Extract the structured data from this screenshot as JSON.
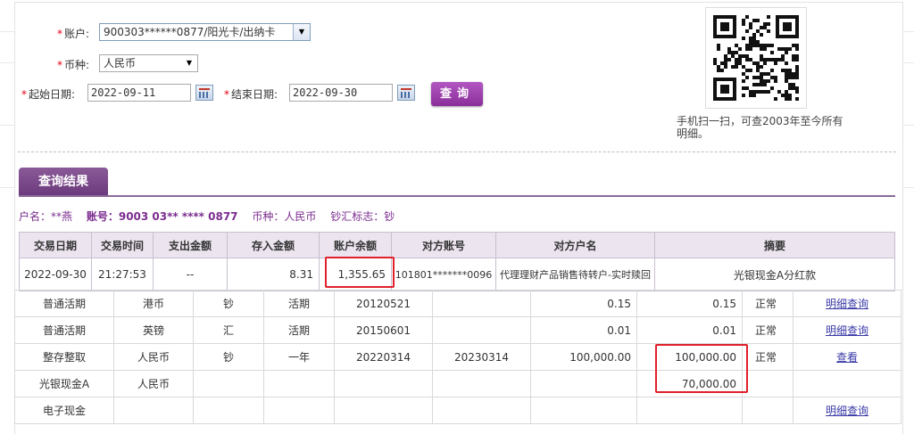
{
  "form": {
    "account_label": "账户:",
    "account_value": "900303******0877/阳光卡/出纳卡",
    "currency_label": "币种:",
    "currency_value": "人民币",
    "start_label": "起始日期:",
    "start_value": "2022-09-11",
    "end_label": "结束日期:",
    "end_value": "2022-09-30",
    "query_button": "查询"
  },
  "qr": {
    "caption": "手机扫一扫，可查2003年至今所有明细。"
  },
  "results": {
    "tab": "查询结果",
    "name": "户名：**燕",
    "account": "账号：9003 03** **** 0877",
    "currency": "币种：人民币",
    "cash_flag": "钞汇标志：钞"
  },
  "transactions": {
    "headers": [
      "交易日期",
      "交易时间",
      "支出金额",
      "存入金额",
      "账户余额",
      "对方账号",
      "对方户名",
      "摘要"
    ],
    "rows": [
      [
        "2022-09-30",
        "21:27:53",
        "--",
        "8.31",
        "1,355.65",
        "101801*******0096",
        "代理理财产品销售待转户-实时赎回",
        "光银现金A分红款"
      ]
    ]
  },
  "deposits": {
    "rows": [
      [
        "普通活期",
        "港币",
        "钞",
        "活期",
        "20120521",
        "",
        "0.15",
        "0.15",
        "正常",
        "明细查询"
      ],
      [
        "普通活期",
        "英镑",
        "汇",
        "活期",
        "20150601",
        "",
        "0.01",
        "0.01",
        "正常",
        "明细查询"
      ],
      [
        "整存整取",
        "人民币",
        "钞",
        "一年",
        "20220314",
        "20230314",
        "100,000.00",
        "100,000.00",
        "正常",
        "查看"
      ],
      [
        "光银现金A",
        "人民币",
        "",
        "",
        "",
        "",
        "",
        "70,000.00",
        "",
        ""
      ],
      [
        "电子现金",
        "",
        "",
        "",
        "",
        "",
        "",
        "",
        "",
        "明细查询"
      ]
    ]
  },
  "colors": {
    "accent": "#8a2f9a",
    "highlight": "#e0202a",
    "link": "#3a3aa8"
  }
}
